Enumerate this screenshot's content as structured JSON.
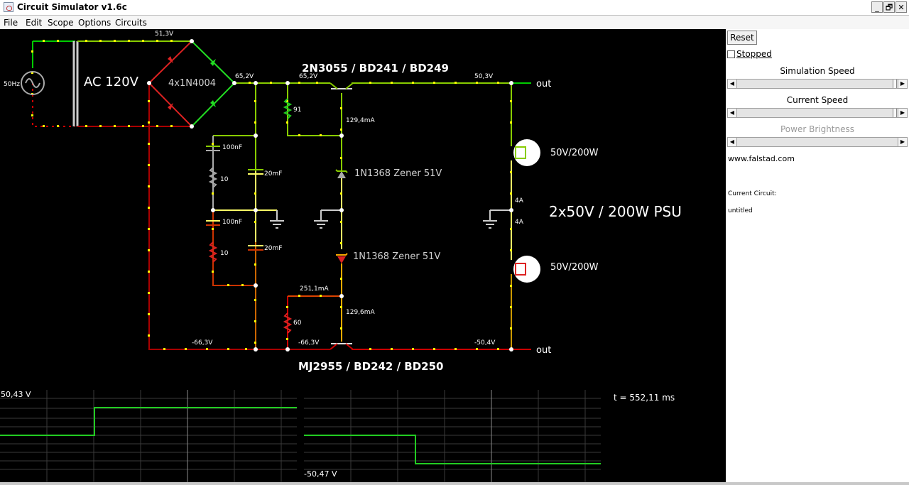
{
  "window": {
    "title": "Circuit Simulator v1.6c",
    "buttons": [
      "_",
      "🗗",
      "✕"
    ]
  },
  "menu": [
    "File",
    "Edit",
    "Scope",
    "Options",
    "Circuits"
  ],
  "circuit": {
    "source_freq": "50Hz",
    "source_label": "AC 120V",
    "bridge_label": "4x1N4004",
    "npn_label": "2N3055 / BD241 / BD249",
    "pnp_label": "MJ2955 / BD242 / BD250",
    "zener_top": "1N1368 Zener 51V",
    "zener_bottom": "1N1368 Zener 51V",
    "title": "2x50V / 200W PSU",
    "lamp_top": "50V/200W",
    "lamp_bottom": "50V/200W",
    "out_top": "out",
    "out_bottom": "out",
    "v_51_3": "51,3V",
    "v_65_2a": "65,2V",
    "v_65_2b": "65,2V",
    "v_50_3": "50,3V",
    "v_m66_3a": "-66,3V",
    "v_m66_3b": "-66,3V",
    "v_m50_4": "-50,4V",
    "r_91": "91",
    "r_10a": "10",
    "r_10b": "10",
    "r_60": "60",
    "c_100nf_a": "100nF",
    "c_100nf_b": "100nF",
    "c_20mf_a": "20mF",
    "c_20mf_b": "20mF",
    "i_129_4": "129,4mA",
    "i_251_1": "251,1mA",
    "i_129_6": "129,6mA",
    "i_4a_top": "4A",
    "i_4a_bottom": "4A"
  },
  "scope": {
    "left_label": "50,43 V",
    "right_label": "-50,47 V",
    "time": "t = 552,11 ms"
  },
  "panel": {
    "reset": "Reset",
    "stopped": "Stopped",
    "sim_speed": "Simulation Speed",
    "current_speed": "Current Speed",
    "power_brightness": "Power Brightness",
    "website": "www.falstad.com",
    "current_circuit_label": "Current Circuit:",
    "current_circuit_name": "untitled"
  }
}
